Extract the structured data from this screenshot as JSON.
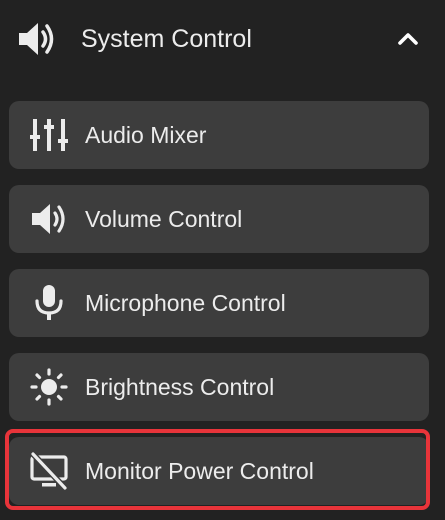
{
  "header": {
    "title": "System Control",
    "icon": "volume-icon",
    "chevron": "chevron-up-icon",
    "expanded": true
  },
  "items": [
    {
      "label": "Audio Mixer",
      "icon": "sliders-icon",
      "selected": false
    },
    {
      "label": "Volume Control",
      "icon": "volume-icon",
      "selected": false
    },
    {
      "label": "Microphone Control",
      "icon": "microphone-icon",
      "selected": false
    },
    {
      "label": "Brightness Control",
      "icon": "brightness-icon",
      "selected": false
    },
    {
      "label": "Monitor Power Control",
      "icon": "monitor-off-icon",
      "selected": true
    }
  ],
  "colors": {
    "background": "#222222",
    "item_background": "#3d3d3d",
    "text": "#ececec",
    "selection_outline": "#e8343a"
  }
}
